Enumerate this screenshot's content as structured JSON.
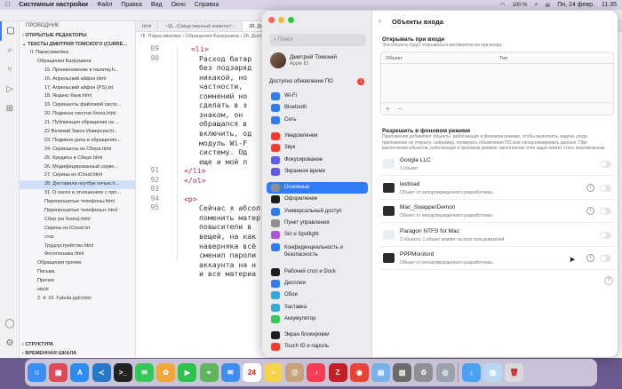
{
  "menubar": {
    "app": "Системные настройки",
    "items": [
      "Файл",
      "Правка",
      "Вид",
      "Окно",
      "Справка"
    ],
    "battery": "100 %",
    "datetime": "Пн, 24 февр.",
    "time": "11:35"
  },
  "vscode": {
    "explorer_title": "ПРОВОДНИК",
    "open_editors": "ОТКРЫТЫЕ РЕДАКТОРЫ",
    "project": "ТЕКСТЫ ДМИТРИЯ ТОМСКОГО (CURRE...",
    "tree": [
      {
        "label": "II. Парасоматика",
        "depth": 1
      },
      {
        "label": "Обращения Бахрушина",
        "depth": 2
      },
      {
        "label": "15. Проникновение в палатку.h...",
        "depth": 3
      },
      {
        "label": "16. Апрельский айфон.html",
        "depth": 3
      },
      {
        "label": "17. Апрельский айфон (PS).txt",
        "depth": 3
      },
      {
        "label": "18. Яндекс-банк.html",
        "depth": 3
      },
      {
        "label": "19. Скриншоты файловой систе...",
        "depth": 3
      },
      {
        "label": "20. Подмена текстов блога.html",
        "depth": 3
      },
      {
        "label": "21. Публикация обращения на ...",
        "depth": 3
      },
      {
        "label": "22 Великий Закон Инверсии.ht...",
        "depth": 3
      },
      {
        "label": "23. Подмена даты в обращения...",
        "depth": 3
      },
      {
        "label": "24. Скриншоты из Сбера.html",
        "depth": 3
      },
      {
        "label": "25. Кредиты в Сбере.html",
        "depth": 3
      },
      {
        "label": "26. Модифицированный серве...",
        "depth": 3
      },
      {
        "label": "27. Скрины из iCloud.html",
        "depth": 3
      },
      {
        "label": "28. Доставили ноутбук ночью.h...",
        "depth": 3
      },
      {
        "label": "31. О хаосе в отношениях с про...",
        "depth": 3
      },
      {
        "label": "Перепрошитые телефоны.html",
        "depth": 3
      },
      {
        "label": "Перепрошитые телефоны+.html",
        "depth": 3
      },
      {
        "label": "Сбер (из блога).html",
        "depth": 3
      },
      {
        "label": "Скрины из iCloud.txt",
        "depth": 3
      },
      {
        "label": "сток",
        "depth": 3
      },
      {
        "label": "Трудоустройство.html",
        "depth": 3
      },
      {
        "label": "Фототехника.html",
        "depth": 3
      },
      {
        "label": "Обращения прочие",
        "depth": 2
      },
      {
        "label": "Письма",
        "depth": 2
      },
      {
        "label": "Прочее",
        "depth": 2
      },
      {
        "label": "stock",
        "depth": 2
      },
      {
        "label": "2. 4. 10. Fabula.pptl.html",
        "depth": 2
      }
    ],
    "structure": "СТРУКТУРА",
    "timeline": "ВРЕМЕННАЯ ШКАЛА",
    "tabs": [
      "html",
      "~/Д.../Сведственный комитет/...",
      "28. Доставили"
    ],
    "breadcrumb": "III. Парасоматика › Обращения Бахрушина › 28. Доставили",
    "lines": [
      {
        "num": "89",
        "text": "<li>"
      },
      {
        "num": "90",
        "text": "Расход батар"
      },
      {
        "num": "",
        "text": "без подзаряд"
      },
      {
        "num": "",
        "text": "никакой, но"
      },
      {
        "num": "",
        "text": "частности,"
      },
      {
        "num": "",
        "text": "сомнений но"
      },
      {
        "num": "",
        "text": "сделать в э"
      },
      {
        "num": "",
        "text": "знаком, он"
      },
      {
        "num": "",
        "text": "обращался в"
      },
      {
        "num": "",
        "text": "включить, од"
      },
      {
        "num": "",
        "text": "модуль Wi-F"
      },
      {
        "num": "",
        "text": "систему. Од"
      },
      {
        "num": "",
        "text": "еще и мой п"
      },
      {
        "num": "91",
        "text": "</li>"
      },
      {
        "num": "92",
        "text": "</ol>"
      },
      {
        "num": "93",
        "text": ""
      },
      {
        "num": "94",
        "text": "<p>"
      },
      {
        "num": "95",
        "text": "Сейчас я абсол"
      },
      {
        "num": "",
        "text": "поменить матер"
      },
      {
        "num": "",
        "text": "повысители в"
      },
      {
        "num": "",
        "text": "вещей, на как"
      },
      {
        "num": "",
        "text": "наверняка всё"
      },
      {
        "num": "",
        "text": "сменил пароли"
      },
      {
        "num": "",
        "text": "аккаунта на н"
      },
      {
        "num": "",
        "text": "и все материа"
      }
    ]
  },
  "settings": {
    "search_placeholder": "Поиск",
    "account": {
      "name": "Дмитрий Томский",
      "sub": "Apple ID"
    },
    "update": {
      "label": "Доступно обновление ПО",
      "badge": "1"
    },
    "nav": [
      {
        "label": "Wi-Fi",
        "color": "#2f7cf6"
      },
      {
        "label": "Bluetooth",
        "color": "#2f7cf6"
      },
      {
        "label": "Сеть",
        "color": "#2f7cf6"
      },
      {
        "label": "Уведомления",
        "color": "#ff3b30"
      },
      {
        "label": "Звук",
        "color": "#ff3b30"
      },
      {
        "label": "Фокусирование",
        "color": "#5e5ce6"
      },
      {
        "label": "Экранное время",
        "color": "#5e5ce6"
      },
      {
        "label": "Основные",
        "color": "#8e8e93",
        "active": true
      },
      {
        "label": "Оформление",
        "color": "#1c1c1e"
      },
      {
        "label": "Универсальный доступ",
        "color": "#2f7cf6"
      },
      {
        "label": "Пункт управления",
        "color": "#8e8e93"
      },
      {
        "label": "Siri и Spotlight",
        "color": "#af52de"
      },
      {
        "label": "Конфиденциальность и безопасность",
        "color": "#2f7cf6",
        "two": true
      },
      {
        "label": "Рабочий стол и Dock",
        "color": "#1c1c1e"
      },
      {
        "label": "Дисплеи",
        "color": "#2f7cf6"
      },
      {
        "label": "Обои",
        "color": "#34aadc"
      },
      {
        "label": "Заставка",
        "color": "#34aadc"
      },
      {
        "label": "Аккумулятор",
        "color": "#34c759"
      },
      {
        "label": "Экран блокировки",
        "color": "#1c1c1e"
      },
      {
        "label": "Touch ID и пароль",
        "color": "#ff3b30"
      }
    ],
    "page_title": "Объекты входа",
    "open_at_login": {
      "heading": "Открывать при входе",
      "desc": "Эти объекты будут открываться автоматически при входе.",
      "col_object": "Объект",
      "col_type": "Тип",
      "add": "+",
      "remove": "−"
    },
    "background": {
      "heading": "Разрешить в фоновом режиме",
      "desc": "Приложения добавляют объекты, работающие в фоновом режиме, чтобы выполнять задачи, когда приложение не открыто: например, проверять обновления ПО или синхронизировать данные. При выключении объектов, работающих в фоновом режиме, выполнение этих задач может стать невозможным.",
      "items": [
        {
          "name": "Google LLC",
          "sub": "1 объект",
          "icon": "light",
          "info": false
        },
        {
          "name": "lextload",
          "sub": "Объект от неподтвержденного разработчика.",
          "icon": "dark",
          "info": true
        },
        {
          "name": "Mac_SwapperDemon",
          "sub": "Объект от неподтвержденного разработчика.",
          "icon": "dark",
          "info": true
        },
        {
          "name": "Paragon NTFS for Mac",
          "sub": "2 объекта: 1 объект влияет на всех пользователей",
          "icon": "light",
          "info": false
        },
        {
          "name": "PPPMonitord",
          "sub": "Объект от неподтвержденного разработчика.",
          "icon": "dark",
          "info": true
        }
      ]
    },
    "help": "?"
  },
  "dock": {
    "apps": [
      {
        "name": "Finder",
        "color": "#3a8ef6",
        "glyph": "☺"
      },
      {
        "name": "Launchpad",
        "color": "#e04a58",
        "glyph": "▦"
      },
      {
        "name": "App Store",
        "color": "#2c8cf4",
        "glyph": "A"
      },
      {
        "name": "VS Code",
        "color": "#2779c7",
        "glyph": "≺"
      },
      {
        "name": "Terminal",
        "color": "#222222",
        "glyph": ">_"
      },
      {
        "name": "Messages",
        "color": "#34c759",
        "glyph": "✉"
      },
      {
        "name": "Photos",
        "color": "#f2a63b",
        "glyph": "✿"
      },
      {
        "name": "FaceTime",
        "color": "#2fc24d",
        "glyph": "▶"
      },
      {
        "name": "Maps",
        "color": "#5fb65a",
        "glyph": "⌖"
      },
      {
        "name": "Mail",
        "color": "#3d8cf0",
        "glyph": "✉"
      },
      {
        "name": "Calendar",
        "color": "#ffffff",
        "glyph": "24",
        "dark": true
      },
      {
        "name": "Notes",
        "color": "#f7d34a",
        "glyph": "≡"
      },
      {
        "name": "Contacts",
        "color": "#c8a07a",
        "glyph": "@"
      },
      {
        "name": "Music",
        "color": "#fa3c55",
        "glyph": "♪"
      },
      {
        "name": "FileZilla",
        "color": "#c22026",
        "glyph": "Z"
      },
      {
        "name": "Chrome",
        "color": "#ea4335",
        "glyph": "◉"
      },
      {
        "name": "Preview",
        "color": "#7ab0e8",
        "glyph": "▤"
      },
      {
        "name": "Stickies",
        "color": "#6b6b6b",
        "glyph": "▥"
      },
      {
        "name": "System Settings",
        "color": "#8e8e93",
        "glyph": "⚙"
      },
      {
        "name": "Disk Utility",
        "color": "#9aa3ad",
        "glyph": "◎"
      },
      {
        "name": "Downloads",
        "color": "#4aa3f0",
        "glyph": "↓"
      },
      {
        "name": "Documents",
        "color": "#b9d6f5",
        "glyph": "▧"
      },
      {
        "name": "Trash",
        "color": "#d9d9de",
        "glyph": "🗑",
        "dark": true
      }
    ]
  }
}
